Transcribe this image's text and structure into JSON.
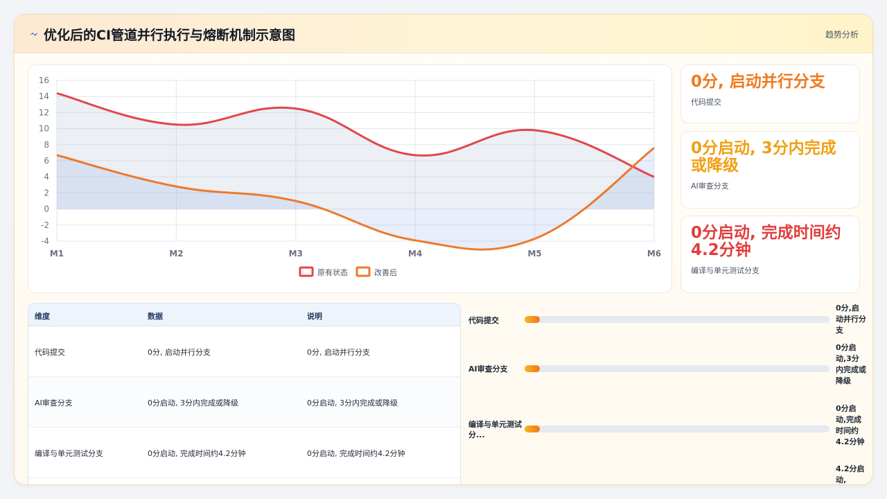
{
  "header": {
    "title": "优化后的CI管道并行执行与熔断机制示意图",
    "link": "趋势分析",
    "logo_icon": "lightning-icon"
  },
  "colors": {
    "original": "#e0474c",
    "improved": "#ec7a2c",
    "kpi1": "#ee7a1e",
    "kpi2": "#f0a012",
    "kpi3": "#e33c3c"
  },
  "chart_data": {
    "type": "line",
    "categories": [
      "M1",
      "M2",
      "M3",
      "M4",
      "M5",
      "M6"
    ],
    "series": [
      {
        "name": "原有状态",
        "values": [
          14.4,
          10.5,
          12.5,
          6.7,
          9.8,
          4.0
        ]
      },
      {
        "name": "改善后",
        "values": [
          6.7,
          2.8,
          1.0,
          -3.9,
          -3.7,
          7.6
        ]
      }
    ],
    "ylim": [
      -4,
      16
    ],
    "yticks": [
      "-4",
      "-2",
      "0",
      "2",
      "4",
      "6",
      "8",
      "10",
      "12",
      "14",
      "16"
    ],
    "grid": true,
    "legend": "bottom"
  },
  "kpis": [
    {
      "value": "0分, 启动并行分支",
      "label": "代码提交"
    },
    {
      "value": "0分启动, 3分内完成或降级",
      "label": "AI审查分支"
    },
    {
      "value": "0分启动, 完成时间约4.2分钟",
      "label": "编译与单元测试分支"
    }
  ],
  "table": {
    "headers": [
      "维度",
      "数据",
      "说明"
    ],
    "rows": [
      [
        "代码提交",
        "0分, 启动并行分支",
        "0分, 启动并行分支"
      ],
      [
        "AI审查分支",
        "0分启动, 3分内完成或降级",
        "0分启动, 3分内完成或降级"
      ],
      [
        "编译与单元测试分支",
        "0分启动, 完成时间约4.2分钟",
        "0分启动, 完成时间约4.2分钟"
      ]
    ]
  },
  "bars": [
    {
      "label": "代码提交",
      "value": "0分,启动并行分支",
      "fill": 0.05
    },
    {
      "label": "AI审查分支",
      "value": "0分启动,3分内完成或降级",
      "fill": 0.05
    },
    {
      "label": "编译与单元测试分...",
      "value": "0分启动,完成时间约4.2分钟",
      "fill": 0.05
    },
    {
      "label": "",
      "value": "4.2分启动,",
      "fill": 0
    }
  ]
}
